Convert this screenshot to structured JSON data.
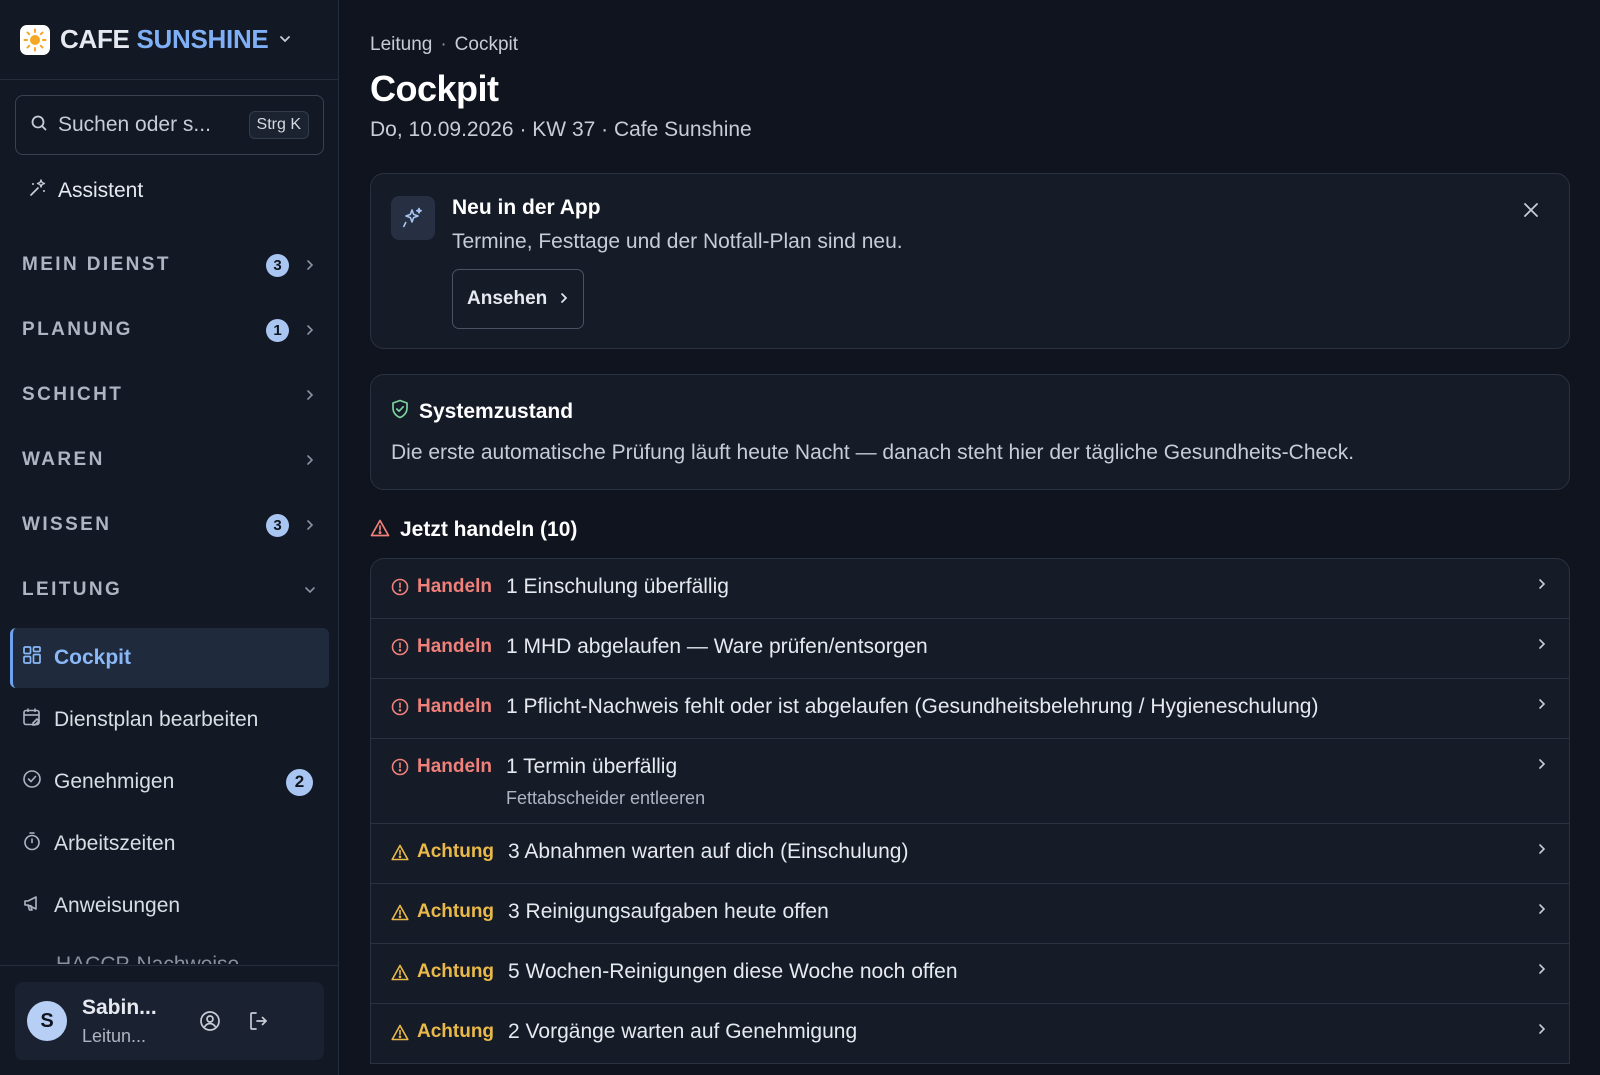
{
  "brand": {
    "name_part1": "CAFE",
    "name_part2": "SUNSHINE"
  },
  "search": {
    "placeholder": "Suchen oder s...",
    "shortcut": "Strg K"
  },
  "assistant": {
    "label": "Assistent"
  },
  "sections": [
    {
      "label": "MEIN DIENST",
      "count": "3"
    },
    {
      "label": "PLANUNG",
      "count": "1"
    },
    {
      "label": "SCHICHT"
    },
    {
      "label": "WAREN"
    },
    {
      "label": "WISSEN",
      "count": "3"
    },
    {
      "label": "LEITUNG"
    }
  ],
  "nav": [
    {
      "label": "Cockpit",
      "icon": "grid-icon",
      "active": true
    },
    {
      "label": "Dienstplan bearbeiten",
      "icon": "calendar-edit-icon"
    },
    {
      "label": "Genehmigen",
      "icon": "check-circle-icon",
      "count": "2"
    },
    {
      "label": "Arbeitszeiten",
      "icon": "stopwatch-icon"
    },
    {
      "label": "Anweisungen",
      "icon": "megaphone-icon"
    },
    {
      "label": "HACCP-Nachweise",
      "icon": "shield-icon"
    }
  ],
  "user": {
    "initial": "S",
    "name": "Sabin...",
    "role": "Leitun..."
  },
  "breadcrumb": [
    "Leitung",
    "Cockpit"
  ],
  "breadcrumb_sep": "·",
  "page": {
    "title": "Cockpit",
    "subtitle": "Do, 10.09.2026 · KW 37 · Cafe Sunshine"
  },
  "news": {
    "title": "Neu in der App",
    "text": "Termine, Festtage und der Notfall-Plan sind neu.",
    "button": "Ansehen"
  },
  "system": {
    "title": "Systemzustand",
    "text": "Die erste automatische Prüfung läuft heute Nacht — danach steht hier der tägliche Gesundheits-Check."
  },
  "actions": {
    "title": "Jetzt handeln (10)",
    "items": [
      {
        "severity": "Handeln",
        "level": "red",
        "text": "1 Einschulung überfällig"
      },
      {
        "severity": "Handeln",
        "level": "red",
        "text": "1 MHD abgelaufen — Ware prüfen/entsorgen"
      },
      {
        "severity": "Handeln",
        "level": "red",
        "text": "1 Pflicht-Nachweis fehlt oder ist abgelaufen (Gesundheitsbelehrung / Hygieneschulung)"
      },
      {
        "severity": "Handeln",
        "level": "red",
        "text": "1 Termin überfällig",
        "sub": "Fettabscheider entleeren"
      },
      {
        "severity": "Achtung",
        "level": "yellow",
        "text": "3 Abnahmen warten auf dich (Einschulung)"
      },
      {
        "severity": "Achtung",
        "level": "yellow",
        "text": "3 Reinigungsaufgaben heute offen"
      },
      {
        "severity": "Achtung",
        "level": "yellow",
        "text": "5 Wochen-Reinigungen diese Woche noch offen"
      },
      {
        "severity": "Achtung",
        "level": "yellow",
        "text": "2 Vorgänge warten auf Genehmigung"
      }
    ]
  },
  "colors": {
    "accent": "#7fb0f5",
    "danger": "#f0807a",
    "warning": "#e9b949",
    "background": "#0f141e"
  }
}
